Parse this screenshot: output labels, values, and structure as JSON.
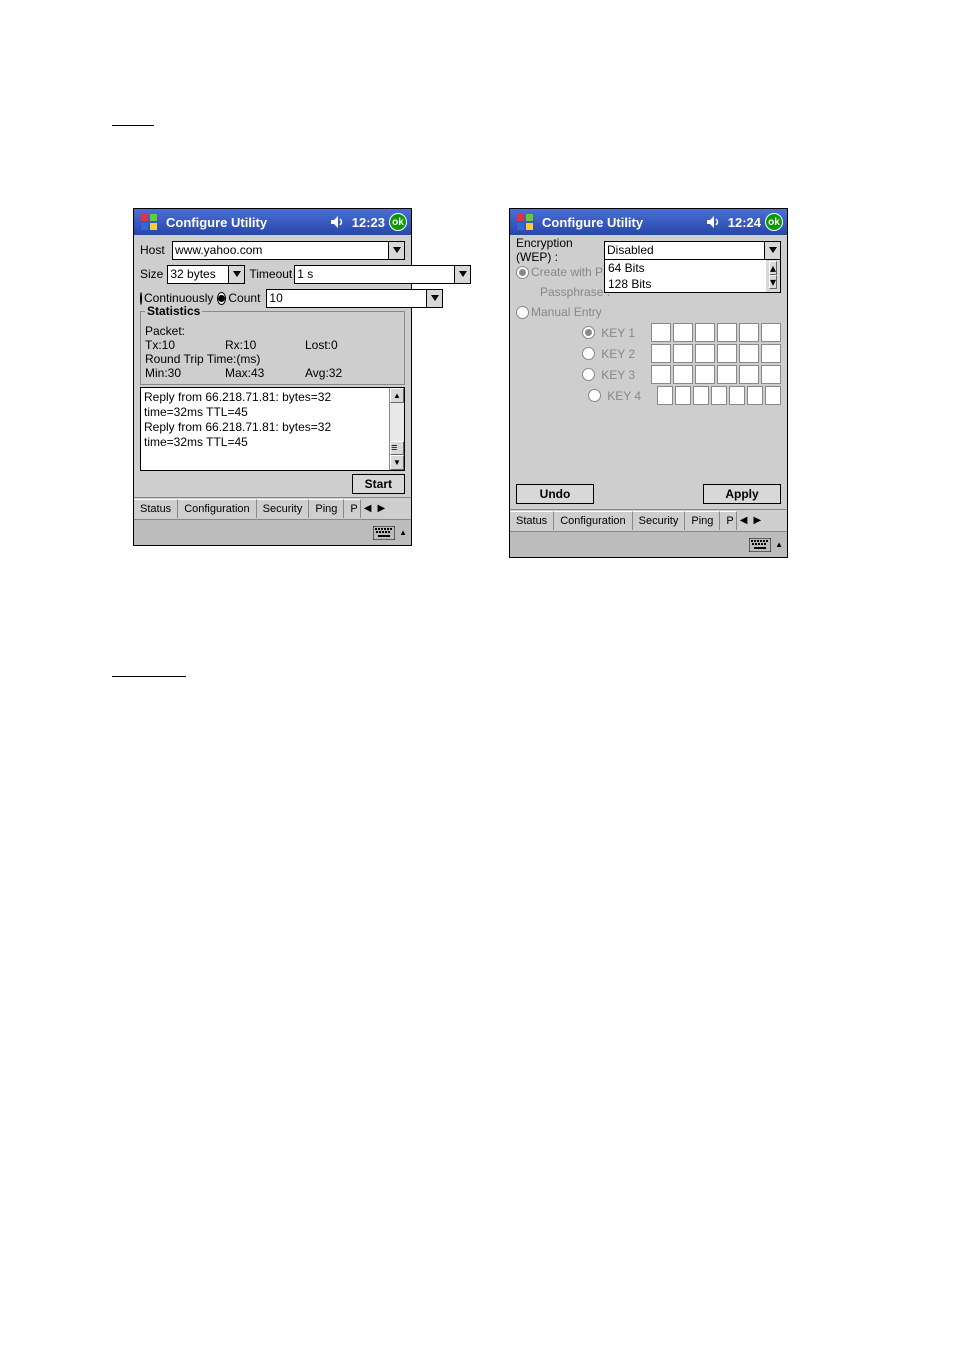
{
  "left": {
    "title": "Configure Utility",
    "time": "12:23",
    "ok": "ok",
    "host_label": "Host",
    "host_value": "www.yahoo.com",
    "size_label": "Size",
    "size_value": "32 bytes",
    "timeout_label": "Timeout",
    "timeout_value": "1 s",
    "continuous_label": "Continuously",
    "count_label": "Count",
    "count_value": "10",
    "stats_title": "Statistics",
    "stats_packet": "Packet:",
    "stats_tx": "Tx:10",
    "stats_rx": "Rx:10",
    "stats_lost": "Lost:0",
    "stats_rtt": "Round Trip Time:(ms)",
    "stats_min": "Min:30",
    "stats_max": "Max:43",
    "stats_avg": "Avg:32",
    "out_l1": "Reply from 66.218.71.81: bytes=32",
    "out_l2": "time=32ms TTL=45",
    "out_l3": "Reply from 66.218.71.81: bytes=32",
    "out_l4": "time=32ms TTL=45",
    "start_btn": "Start",
    "tabs": {
      "t1": "Status",
      "t2": "Configuration",
      "t3": "Security",
      "t4": "Ping",
      "t5": "P"
    }
  },
  "right": {
    "title": "Configure Utility",
    "time": "12:24",
    "ok": "ok",
    "enc_label": "Encryption (WEP) :",
    "enc_value": "Disabled",
    "enc_opt1": "64 Bits",
    "enc_opt2": "128 Bits",
    "create_pass": "Create with Passp",
    "passphrase": "Passphrase :",
    "manual": "Manual Entry",
    "key1": "KEY 1",
    "key2": "KEY 2",
    "key3": "KEY 3",
    "key4": "KEY 4",
    "undo": "Undo",
    "apply": "Apply",
    "tabs": {
      "t1": "Status",
      "t2": "Configuration",
      "t3": "Security",
      "t4": "Ping",
      "t5": "P"
    }
  }
}
